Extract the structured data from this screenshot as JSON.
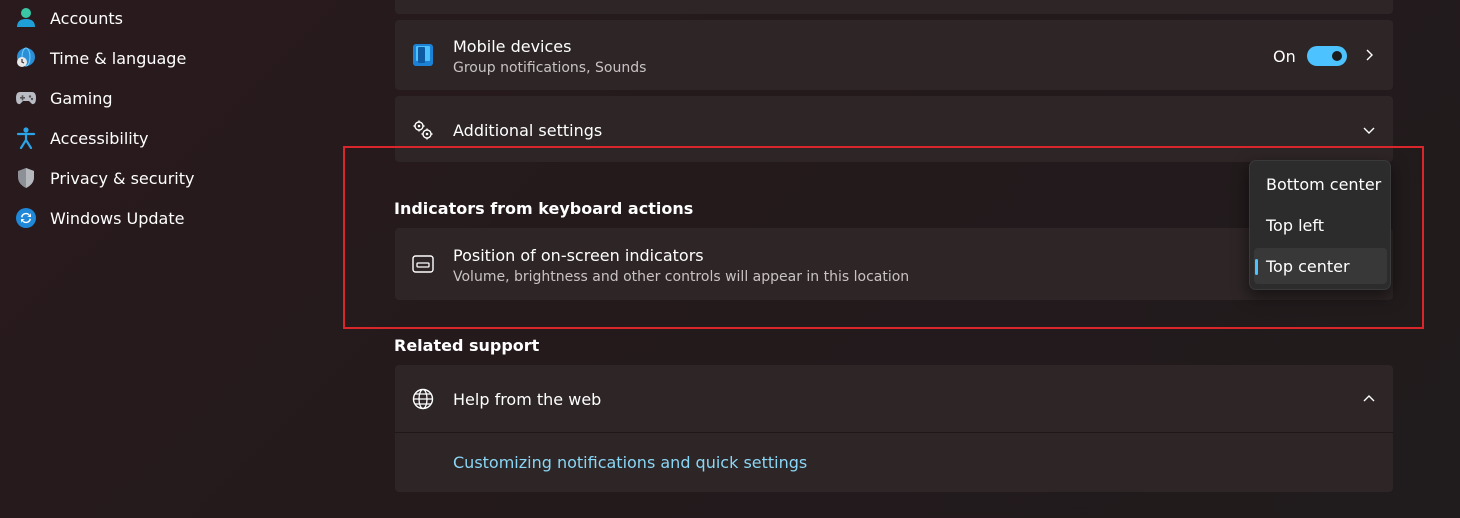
{
  "sidebar": {
    "items": [
      {
        "label": "Accounts",
        "icon": "person-icon"
      },
      {
        "label": "Time & language",
        "icon": "globe-clock-icon"
      },
      {
        "label": "Gaming",
        "icon": "gamepad-icon"
      },
      {
        "label": "Accessibility",
        "icon": "accessibility-icon"
      },
      {
        "label": "Privacy & security",
        "icon": "shield-icon"
      },
      {
        "label": "Windows Update",
        "icon": "sync-icon"
      }
    ]
  },
  "mobile_devices": {
    "title": "Mobile devices",
    "subtitle": "Group notifications, Sounds",
    "toggle_label": "On",
    "toggle_on": true
  },
  "additional_settings": {
    "title": "Additional settings"
  },
  "indicators_section": {
    "header": "Indicators from keyboard actions",
    "position_card": {
      "title": "Position of on-screen indicators",
      "subtitle": "Volume, brightness and other controls will appear in this location"
    },
    "dropdown": {
      "options": [
        "Bottom center",
        "Top left",
        "Top center"
      ],
      "selected": "Top center"
    }
  },
  "related_support": {
    "header": "Related support",
    "help_card": {
      "title": "Help from the web",
      "link": "Customizing notifications and quick settings"
    }
  },
  "colors": {
    "accent": "#4cc2ff",
    "highlight": "#d9262b",
    "link": "#8ad6f5"
  }
}
